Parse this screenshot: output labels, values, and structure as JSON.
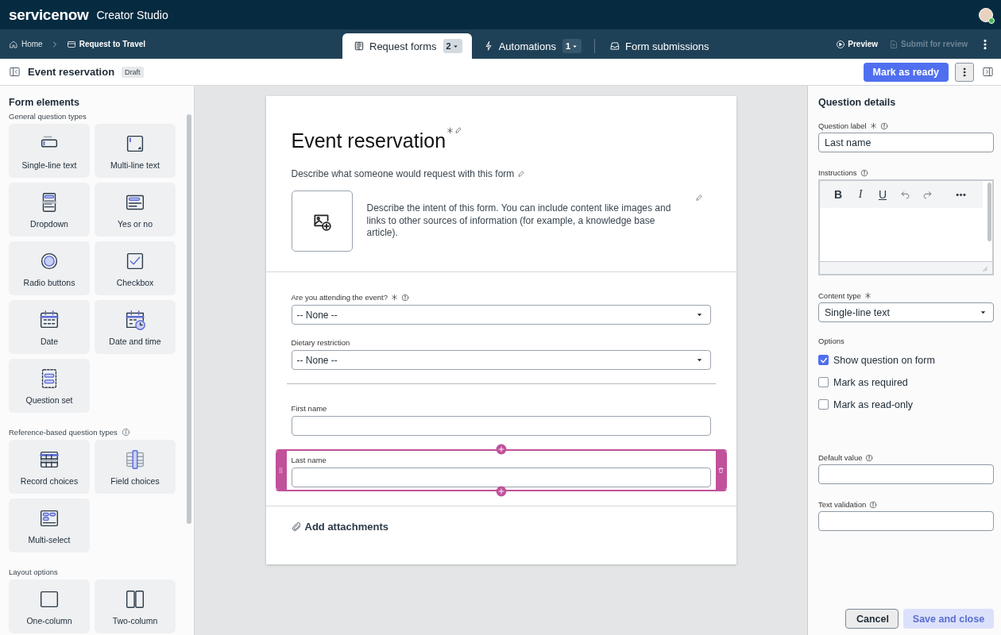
{
  "app_bar": {
    "logo": "servicenow",
    "product": "Creator Studio"
  },
  "breadcrumbs": [
    {
      "label": "Home",
      "kind": "home"
    },
    {
      "label": "Request to Travel",
      "kind": "app"
    }
  ],
  "tabs": [
    {
      "label": "Request forms",
      "kind": "forms",
      "count": "2",
      "selected": true
    },
    {
      "label": "Automations",
      "kind": "automations",
      "count": "1",
      "selected": false
    },
    {
      "label": "Form submissions",
      "kind": "submissions",
      "selected": false
    }
  ],
  "nav_actions": [
    {
      "label": "Preview",
      "kind": "preview",
      "disabled": false
    },
    {
      "label": "Submit for review",
      "kind": "submit",
      "disabled": true
    }
  ],
  "toolbar": {
    "title": "Event reservation",
    "status": "Draft",
    "primary_button": "Mark as ready"
  },
  "sidebar": {
    "title": "Form elements",
    "sections": [
      {
        "heading": "General question types",
        "info": false,
        "items": [
          {
            "label": "Single-line text",
            "kind": "single-line"
          },
          {
            "label": "Multi-line text",
            "kind": "multi-line"
          },
          {
            "label": "Dropdown",
            "kind": "dropdown"
          },
          {
            "label": "Yes or no",
            "kind": "yes-no"
          },
          {
            "label": "Radio buttons",
            "kind": "radio"
          },
          {
            "label": "Checkbox",
            "kind": "checkbox"
          },
          {
            "label": "Date",
            "kind": "date"
          },
          {
            "label": "Date and time",
            "kind": "datetime"
          },
          {
            "label": "Question set",
            "kind": "question-set"
          }
        ]
      },
      {
        "heading": "Reference-based question types",
        "info": true,
        "items": [
          {
            "label": "Record choices",
            "kind": "record"
          },
          {
            "label": "Field choices",
            "kind": "field"
          },
          {
            "label": "Multi-select",
            "kind": "multi-select"
          }
        ]
      },
      {
        "heading": "Layout options",
        "info": false,
        "items": [
          {
            "label": "One-column",
            "kind": "one-column"
          },
          {
            "label": "Two-column",
            "kind": "two-column"
          }
        ]
      }
    ]
  },
  "form": {
    "title": "Event reservation",
    "required": true,
    "description": "Describe what someone would request with this form",
    "intro": "Describe the intent of this form. You can include content like images and links to other sources of information (for example, a knowledge base article).",
    "questions": [
      {
        "kind": "select",
        "label": "Are you attending the event?",
        "required": true,
        "info": true,
        "value": "-- None --",
        "selected": false
      },
      {
        "kind": "select",
        "label": "Dietary restriction",
        "required": false,
        "info": false,
        "value": "-- None --",
        "selected": false
      },
      {
        "kind": "divider"
      },
      {
        "kind": "text",
        "label": "First name",
        "required": false,
        "info": false,
        "selected": false
      },
      {
        "kind": "text",
        "label": "Last name",
        "required": false,
        "info": false,
        "selected": true
      }
    ],
    "attachments": "Add attachments"
  },
  "details": {
    "title": "Question details",
    "question_label": {
      "label": "Question label",
      "required": true,
      "info": true,
      "value": "Last name"
    },
    "instructions": {
      "label": "Instructions",
      "info": true,
      "tools": [
        {
          "kind": "bold",
          "label": "B"
        },
        {
          "kind": "italic",
          "label": "I"
        },
        {
          "kind": "underline",
          "label": "U"
        },
        {
          "kind": "undo"
        },
        {
          "kind": "redo"
        },
        {
          "kind": "more"
        }
      ]
    },
    "content_type": {
      "label": "Content type",
      "required": true,
      "value": "Single-line text"
    },
    "options_heading": "Options",
    "options": [
      {
        "label": "Show question on form",
        "checked": true
      },
      {
        "label": "Mark as required",
        "checked": false
      },
      {
        "label": "Mark as read-only",
        "checked": false
      }
    ],
    "default_value": {
      "label": "Default value",
      "info": true
    },
    "text_validation": {
      "label": "Text validation",
      "info": true
    },
    "buttons": [
      {
        "label": "Cancel",
        "kind": "secondary",
        "disabled": false
      },
      {
        "label": "Save and close",
        "kind": "primary",
        "disabled": true
      }
    ]
  }
}
